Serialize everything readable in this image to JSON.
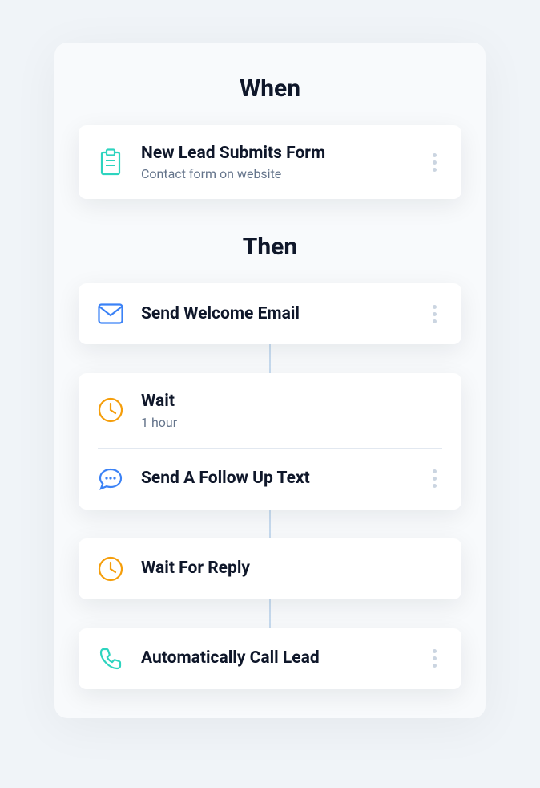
{
  "sections": {
    "when": {
      "header": "When",
      "trigger": {
        "title": "New Lead Submits Form",
        "subtitle": "Contact form on website"
      }
    },
    "then": {
      "header": "Then",
      "steps": {
        "sendEmail": {
          "title": "Send Welcome Email"
        },
        "wait": {
          "title": "Wait",
          "subtitle": "1 hour"
        },
        "followUpText": {
          "title": "Send A Follow Up Text"
        },
        "waitReply": {
          "title": "Wait For Reply"
        },
        "callLead": {
          "title": "Automatically Call Lead"
        }
      }
    }
  }
}
